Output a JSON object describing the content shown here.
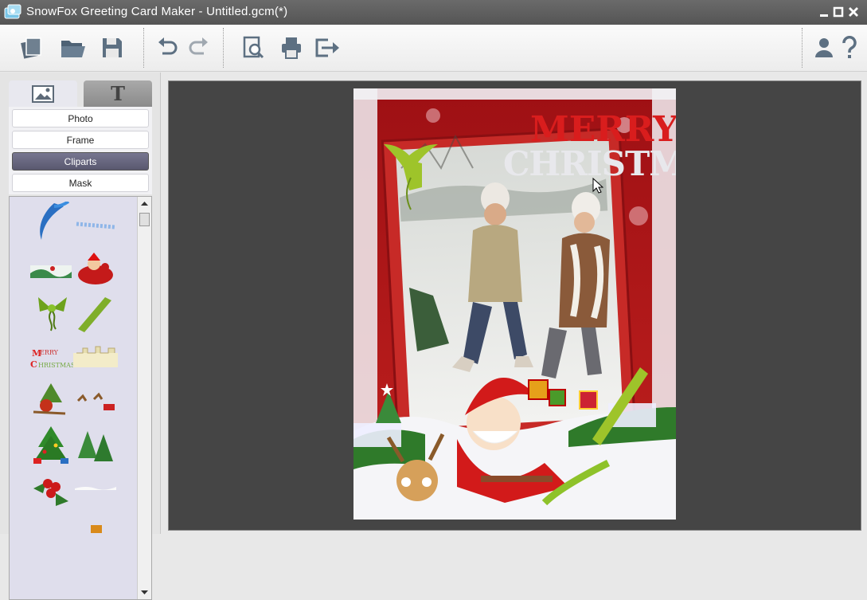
{
  "window": {
    "title": "SnowFox Greeting Card Maker - Untitled.gcm(*)"
  },
  "toolbar": {
    "buttons": [
      "new-card",
      "open",
      "save",
      "undo",
      "redo",
      "preview",
      "print",
      "export",
      "account",
      "help"
    ]
  },
  "left_panel": {
    "tabs": [
      {
        "name": "image",
        "icon": "picture-icon"
      },
      {
        "name": "text",
        "label": "T"
      }
    ],
    "categories": [
      {
        "label": "Photo"
      },
      {
        "label": "Frame"
      },
      {
        "label": "Cliparts",
        "active": true
      },
      {
        "label": "Mask"
      }
    ]
  },
  "card": {
    "greeting_line1": "MERRY",
    "greeting_line2": "CHRISTMAS"
  },
  "colors": {
    "titlebar": "#5e5e5e",
    "canvas_bg": "#454545",
    "active_category": "#66657d",
    "card_red": "#b0161c"
  }
}
